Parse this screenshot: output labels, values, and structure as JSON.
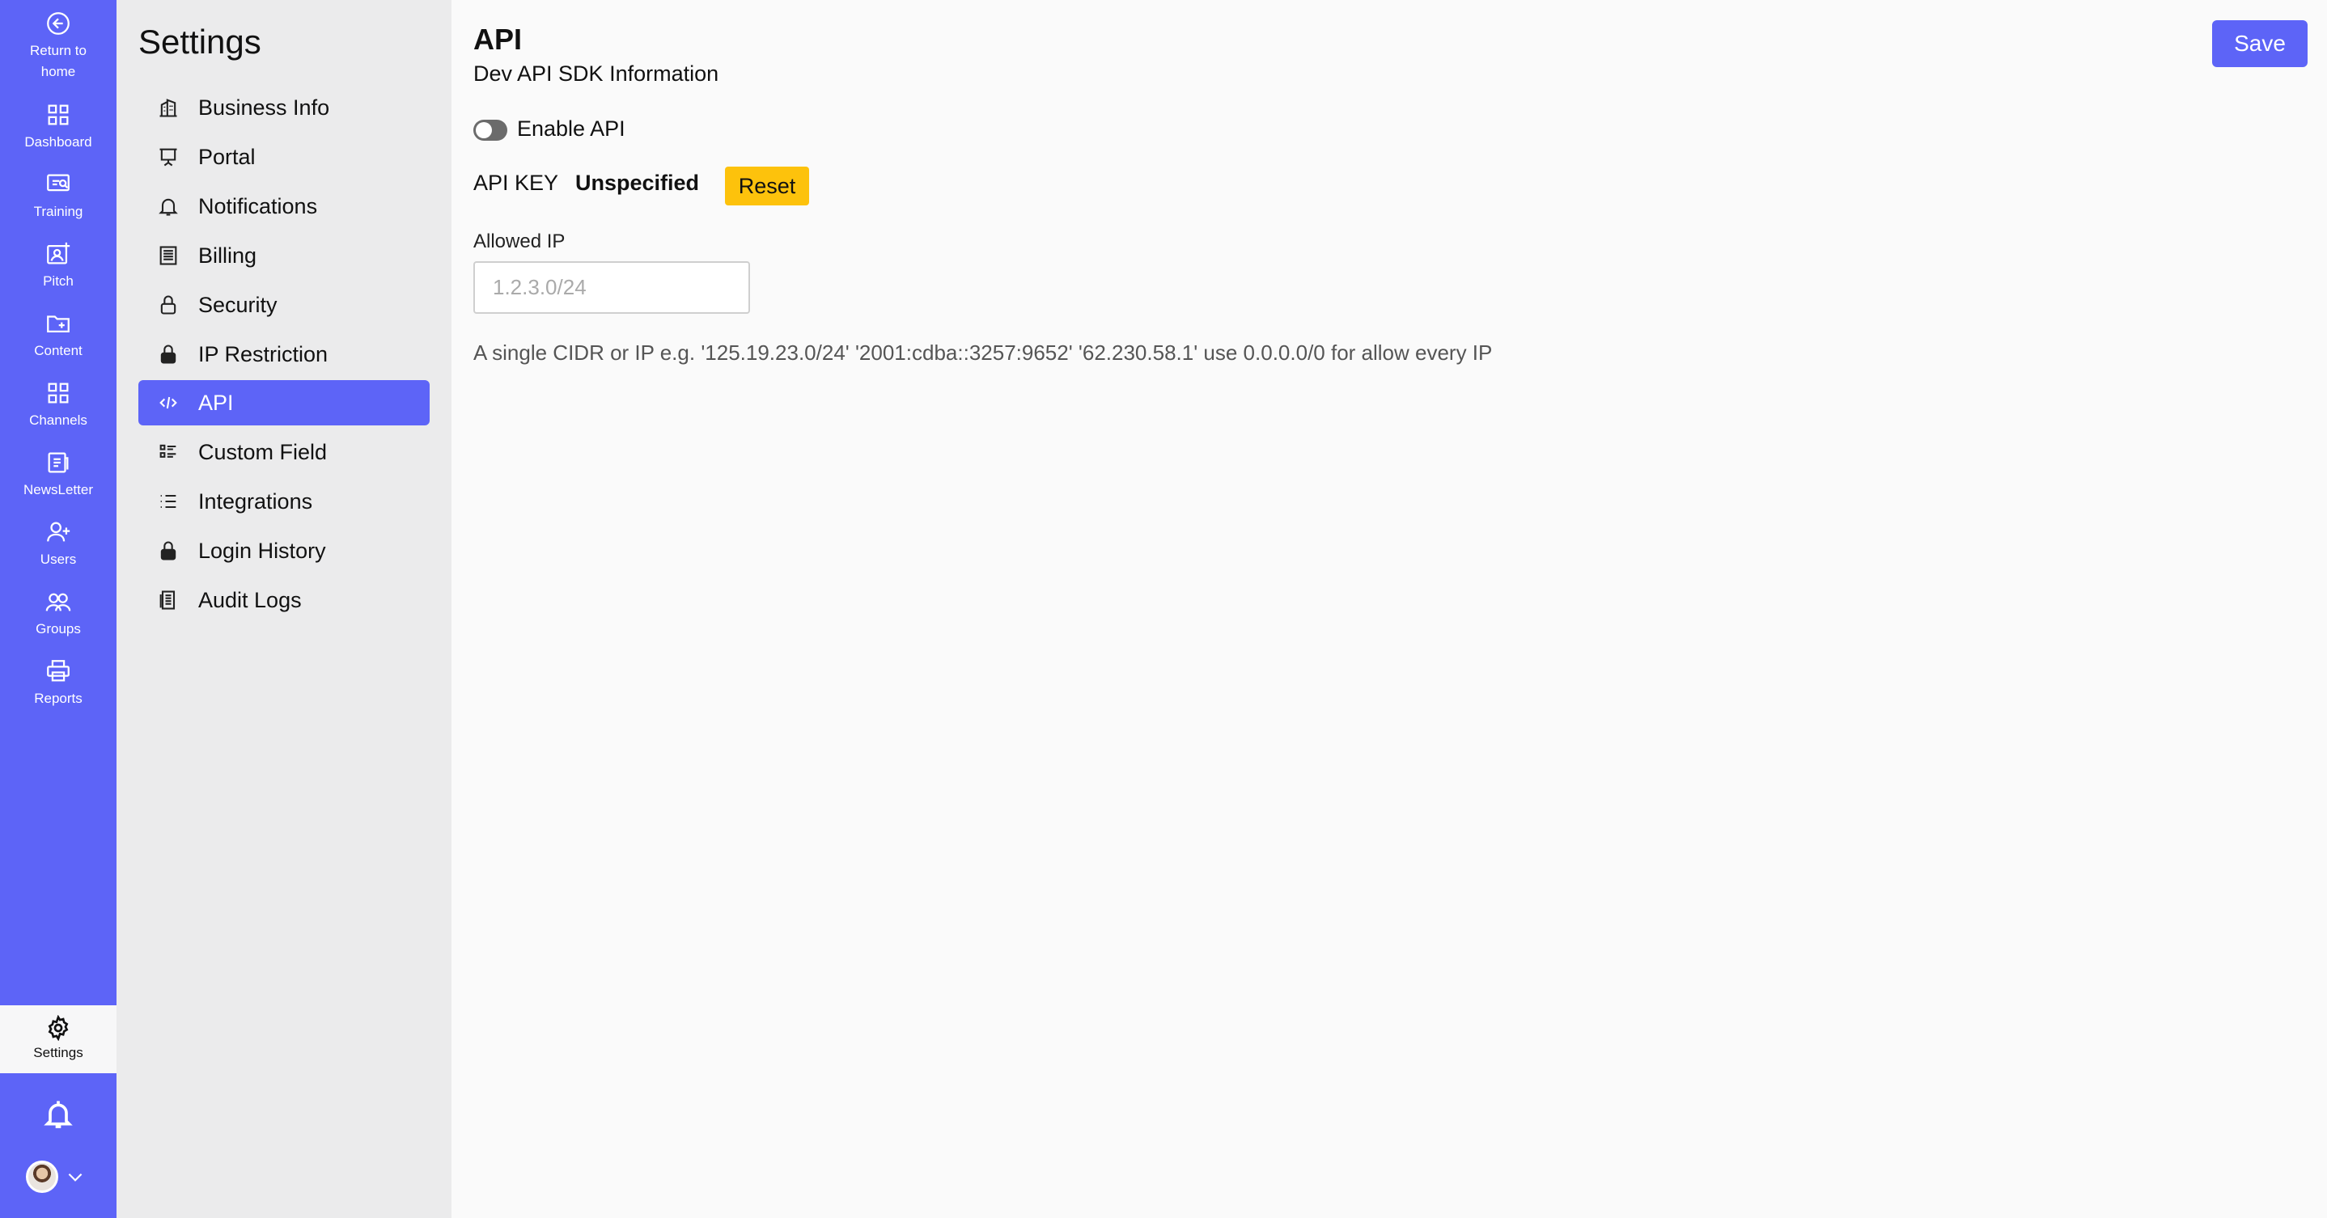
{
  "rail": {
    "return_home": "Return to home",
    "items": [
      {
        "label": "Dashboard",
        "icon": "grid-icon"
      },
      {
        "label": "Training",
        "icon": "training-icon"
      },
      {
        "label": "Pitch",
        "icon": "pitch-icon"
      },
      {
        "label": "Content",
        "icon": "folder-plus-icon"
      },
      {
        "label": "Channels",
        "icon": "grid-icon"
      },
      {
        "label": "NewsLetter",
        "icon": "newsletter-icon"
      },
      {
        "label": "Users",
        "icon": "user-plus-icon"
      },
      {
        "label": "Groups",
        "icon": "users-icon"
      },
      {
        "label": "Reports",
        "icon": "printer-icon"
      }
    ],
    "settings": "Settings",
    "accent": "#5d64f7"
  },
  "settings_menu": {
    "title": "Settings",
    "items": [
      {
        "label": "Business Info",
        "icon": "building-icon"
      },
      {
        "label": "Portal",
        "icon": "presentation-icon"
      },
      {
        "label": "Notifications",
        "icon": "bell-icon"
      },
      {
        "label": "Billing",
        "icon": "billing-icon"
      },
      {
        "label": "Security",
        "icon": "lock-open-icon"
      },
      {
        "label": "IP Restriction",
        "icon": "lock-icon"
      },
      {
        "label": "API",
        "icon": "code-icon",
        "active": true
      },
      {
        "label": "Custom Field",
        "icon": "form-list-icon"
      },
      {
        "label": "Integrations",
        "icon": "list-icon"
      },
      {
        "label": "Login History",
        "icon": "lock-icon"
      },
      {
        "label": "Audit Logs",
        "icon": "audit-icon"
      }
    ]
  },
  "main": {
    "title": "API",
    "subtitle": "Dev API SDK Information",
    "save_label": "Save",
    "enable_api_label": "Enable API",
    "enable_api_on": false,
    "api_key_label": "API KEY",
    "api_key_value": "Unspecified",
    "reset_label": "Reset",
    "allowed_ip_label": "Allowed IP",
    "allowed_ip_placeholder": "1.2.3.0/24",
    "allowed_ip_value": "",
    "help_text": "A single CIDR or IP e.g. '125.19.23.0/24' '2001:cdba::3257:9652' '62.230.58.1' use 0.0.0.0/0 for allow every IP",
    "reset_color": "#fdc20c"
  }
}
